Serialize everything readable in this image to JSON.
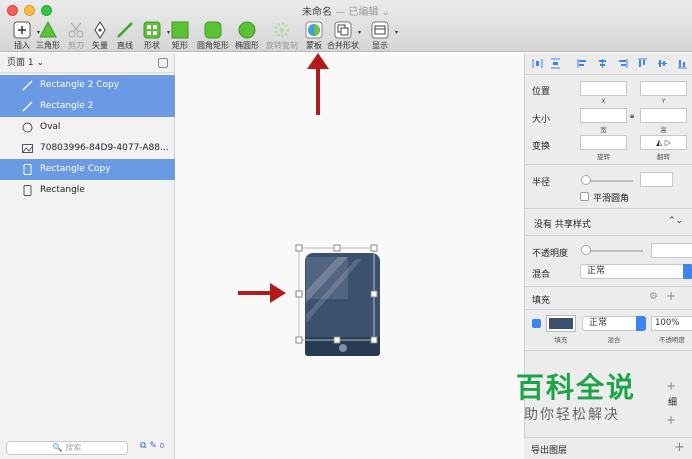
{
  "window": {
    "title": "未命名",
    "subtitle": "— 已编辑 ⌄"
  },
  "toolbar": {
    "items": [
      {
        "label": "插入",
        "icon": "plus-icon"
      },
      {
        "label": "三角形",
        "icon": "triangle-icon"
      },
      {
        "label": "剪刀",
        "icon": "scissors-icon",
        "disabled": true
      },
      {
        "label": "矢量",
        "icon": "pen-icon"
      },
      {
        "label": "直线",
        "icon": "line-icon"
      },
      {
        "label": "形状",
        "icon": "shapes-icon"
      },
      {
        "label": "矩形",
        "icon": "rectangle-icon"
      },
      {
        "label": "圆角矩形",
        "icon": "rounded-rectangle-icon"
      },
      {
        "label": "椭圆形",
        "icon": "oval-icon"
      },
      {
        "label": "旋转复制",
        "icon": "rotate-copy-icon",
        "disabled": true
      },
      {
        "label": "蒙板",
        "icon": "mask-icon"
      },
      {
        "label": "合并形状",
        "icon": "combine-shapes-icon"
      },
      {
        "label": "显示",
        "icon": "view-icon"
      }
    ]
  },
  "sidebar": {
    "page_label": "页面 1 ⌄",
    "layers": [
      {
        "name": "Rectangle 2 Copy",
        "icon": "line-layer-icon",
        "selected": true
      },
      {
        "name": "Rectangle 2",
        "icon": "line-layer-icon",
        "selected": true
      },
      {
        "name": "Oval",
        "icon": "oval-layer-icon",
        "selected": false
      },
      {
        "name": "70803996-84D9-4077-A88...",
        "icon": "image-layer-icon",
        "selected": false
      },
      {
        "name": "Rectangle Copy",
        "icon": "rectangle-layer-icon",
        "selected": true
      },
      {
        "name": "Rectangle",
        "icon": "rectangle-layer-icon",
        "selected": false
      }
    ],
    "search_placeholder": "🔍 搜索",
    "footer_count": "0"
  },
  "inspector": {
    "position_label": "位置",
    "x_label": "X",
    "y_label": "Y",
    "size_label": "大小",
    "width_label": "宽",
    "height_label": "高",
    "transform_label": "变换",
    "rotate_label": "旋转",
    "flip_label": "翻转",
    "radius_label": "半径",
    "smooth_corners_label": "平滑圆角",
    "shared_style": "没有 共享样式",
    "opacity_label": "不透明度",
    "blend_label": "混合",
    "blend_value": "正常",
    "fill_section": "填充",
    "fill_blend": "正常",
    "fill_opacity": "100%",
    "fill_caption": "填充",
    "fill_blend_caption": "混合",
    "fill_opacity_caption": "不透明度",
    "fill_color": "#3c5170",
    "export_label": "导出图层",
    "partial_label": "细"
  },
  "watermark": {
    "title": "百科全说",
    "subtitle": "助你轻松解决"
  },
  "colors": {
    "selection": "#6b9ae5",
    "accent": "#3d84f1",
    "arrow": "#b31b1b",
    "device_body": "#3c5170",
    "device_bottom": "#283a54"
  }
}
